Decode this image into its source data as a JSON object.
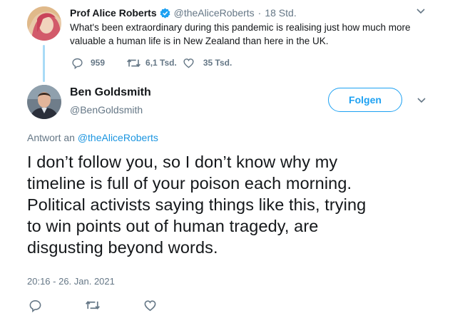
{
  "parent_tweet": {
    "author_name": "Prof Alice Roberts",
    "handle": "@theAliceRoberts",
    "separator": "·",
    "time": "18 Std.",
    "text": "What's been extraordinary during this pandemic is realising just how much more valuable a human life is in New Zealand than here in the UK.",
    "replies": "959",
    "retweets": "6,1 Tsd.",
    "likes": "35 Tsd."
  },
  "main_tweet": {
    "author_name": "Ben Goldsmith",
    "handle": "@BenGoldsmith",
    "follow_label": "Folgen",
    "reply_to_prefix": "Antwort an",
    "reply_to_handle": "@theAliceRoberts",
    "text": "I don’t follow you, so I don’t know why my\ntimeline is full of your poison each morning.\nPolitical activists saying things like this, trying\nto win points out of human tragedy, are\ndisgusting beyond words.",
    "timestamp": "20:16 - 26. Jan. 2021"
  },
  "colors": {
    "accent": "#1da1f2",
    "verified": "#1da1f2",
    "thread_line": "#a9dbf6",
    "muted_text": "#657786"
  },
  "icons": [
    "verified-badge-icon",
    "chevron-down-icon",
    "reply-icon",
    "retweet-icon",
    "like-icon"
  ]
}
